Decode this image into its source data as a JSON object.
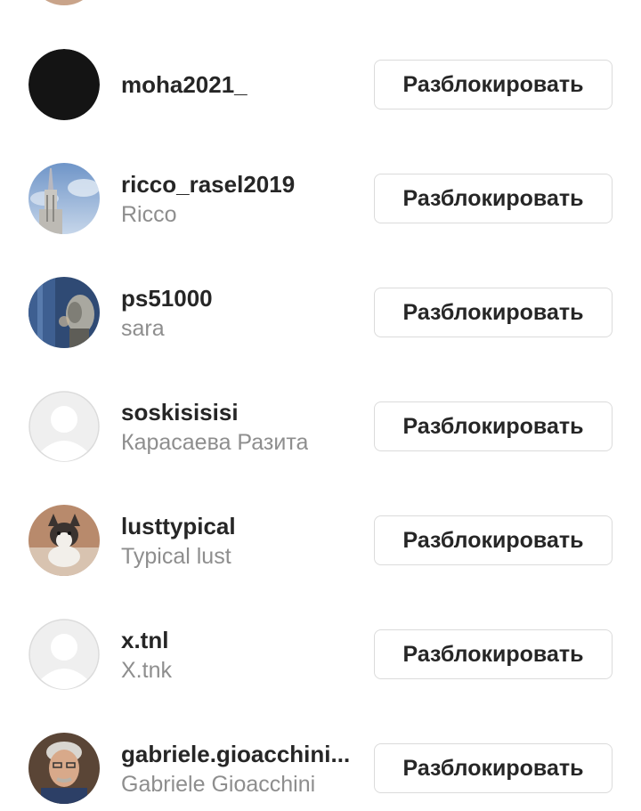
{
  "blocked_list": {
    "unblock_label": "Разблокировать",
    "accounts": [
      {
        "username": "moha2021_",
        "full_name": "",
        "avatar": "black-circle-avatar"
      },
      {
        "username": "ricco_rasel2019",
        "full_name": "Ricco",
        "avatar": "tower-photo-avatar"
      },
      {
        "username": "ps51000",
        "full_name": "sara",
        "avatar": "robot-art-avatar"
      },
      {
        "username": "soskisisisi",
        "full_name": "Карасаева Разита",
        "avatar": "default-avatar"
      },
      {
        "username": "lusttypical",
        "full_name": "Typical lust",
        "avatar": "husky-photo-avatar"
      },
      {
        "username": "x.tnl",
        "full_name": "X.tnk",
        "avatar": "default-avatar"
      },
      {
        "username": "gabriele.gioacchini...",
        "full_name": "Gabriele Gioacchini",
        "avatar": "man-photo-avatar"
      }
    ]
  }
}
